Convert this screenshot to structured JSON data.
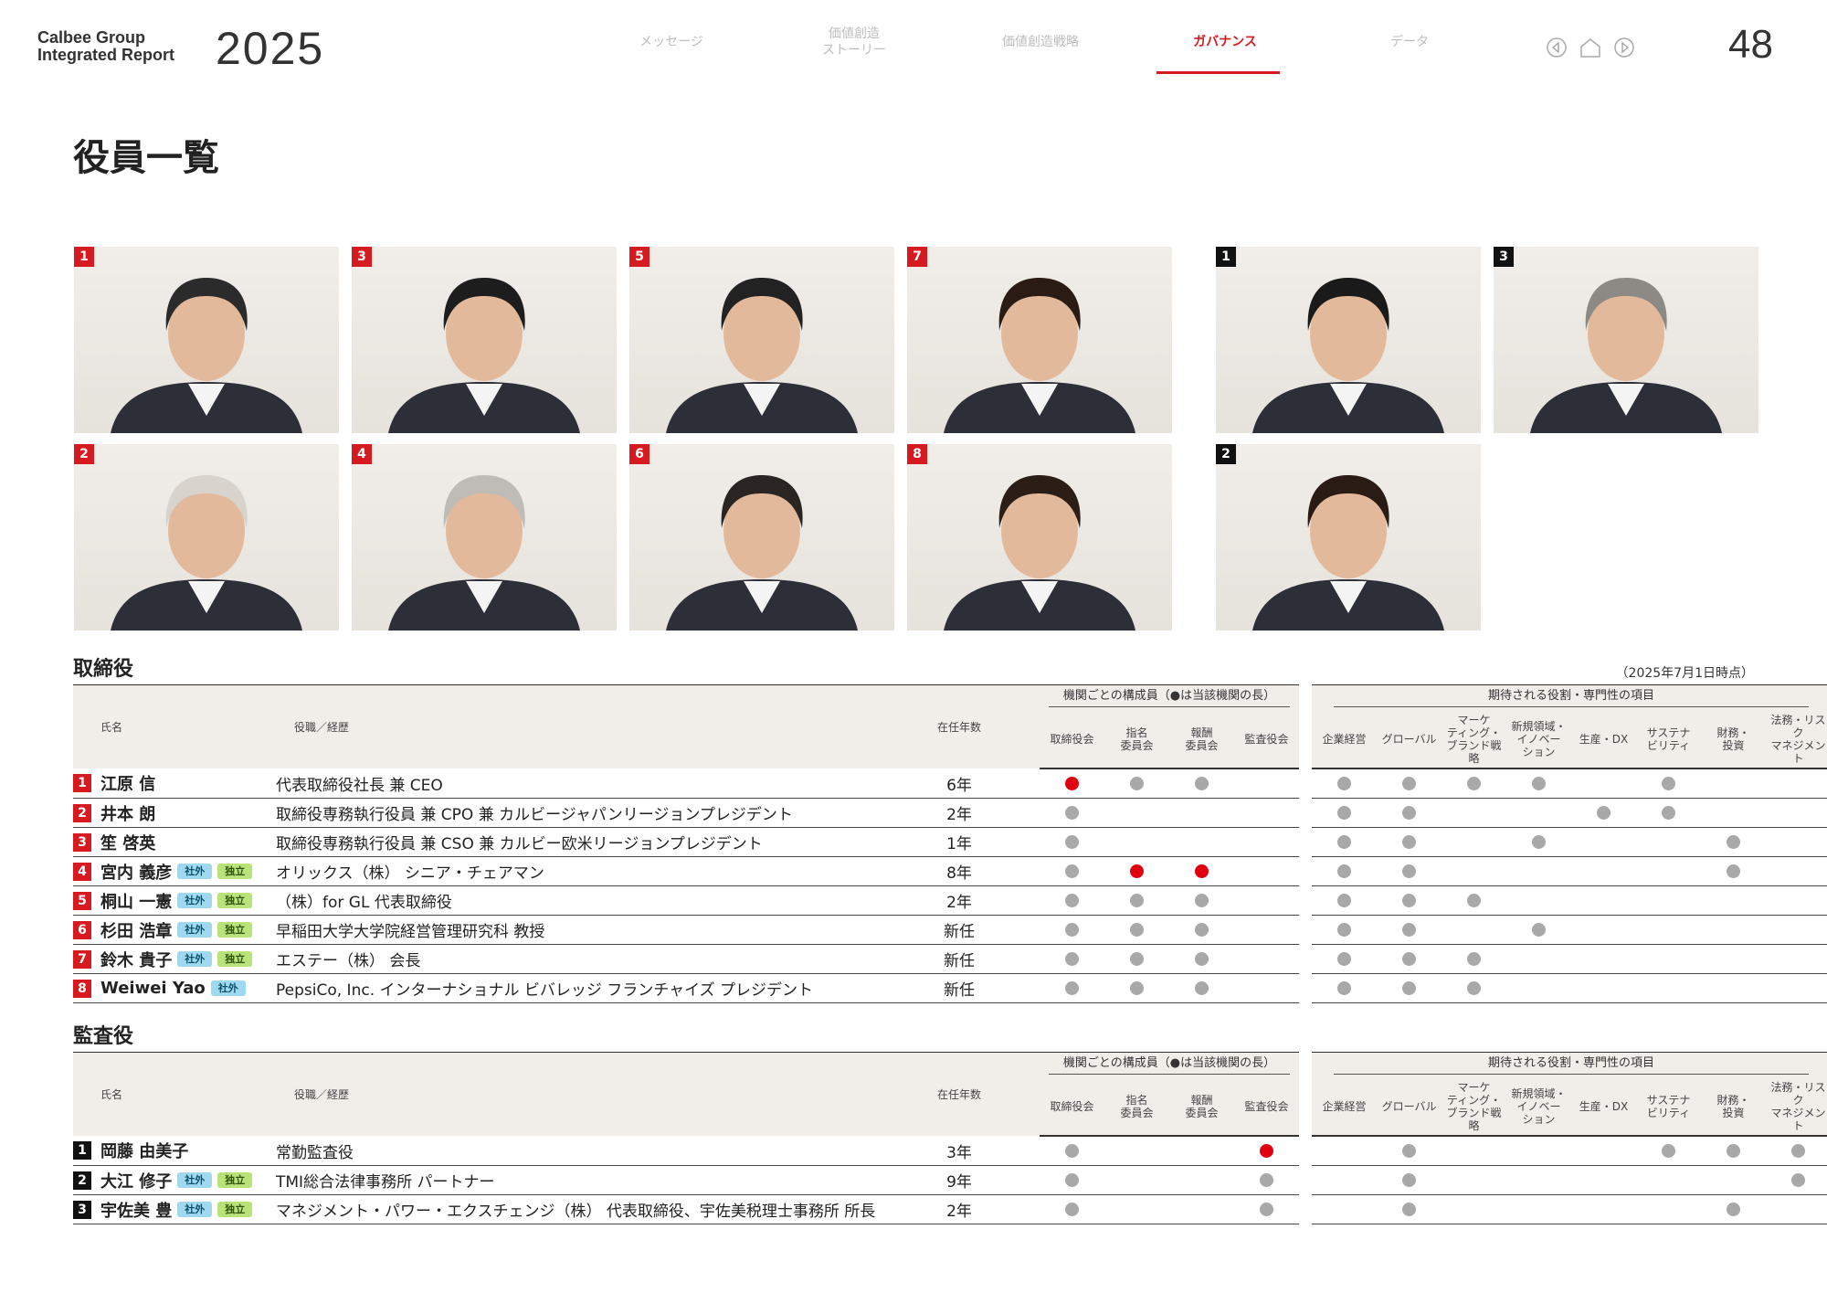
{
  "header": {
    "brand_line1": "Calbee Group",
    "brand_line2": "Integrated Report",
    "year": "2025",
    "page_number": "48",
    "nav": [
      {
        "label": "メッセージ"
      },
      {
        "label": "価値創造\nストーリー"
      },
      {
        "label": "価値創造戦略"
      },
      {
        "label": "ガバナンス"
      },
      {
        "label": "データ"
      }
    ],
    "nav_icons": [
      "prev-arrow-icon",
      "home-icon",
      "next-arrow-icon"
    ]
  },
  "title": "役員一覧",
  "colors": {
    "accent": "#d71920",
    "dot_gray": "#a8a8a8",
    "dot_red": "#e0000f",
    "header_bg": "#f1eeea"
  },
  "photos_directors": [
    "1",
    "3",
    "5",
    "7",
    "2",
    "4",
    "6",
    "8"
  ],
  "photos_auditors": [
    "1",
    "3",
    "2"
  ],
  "table_headers": {
    "name": "氏名",
    "role": "役職／経歴",
    "tenure": "在任年数",
    "group_committee": "機関ごとの構成員（●は当該機関の長）",
    "group_expertise": "期待される役割・専門性の項目",
    "committees": [
      "取締役会",
      "指名\n委員会",
      "報酬\n委員会",
      "監査役会"
    ],
    "expertise": [
      "企業経営",
      "グローバル",
      "マーケ\nティング・\nブランド戦略",
      "新規領域・\nイノベー\nション",
      "生産・DX",
      "サステナ\nビリティ",
      "財務・\n投資",
      "法務・リスク\nマネジメント"
    ]
  },
  "directors": {
    "section_title": "取締役",
    "as_of": "（2025年7月1日時点）",
    "rows": [
      {
        "num": "1",
        "name": "江原 信",
        "tags": [],
        "role": "代表取締役社長 兼 CEO",
        "tenure": "6年",
        "c": [
          "r",
          "g",
          "g",
          ""
        ],
        "e": [
          "g",
          "g",
          "g",
          "g",
          "",
          "g",
          "",
          ""
        ]
      },
      {
        "num": "2",
        "name": "井本 朗",
        "tags": [],
        "role": "取締役専務執行役員 兼 CPO 兼 カルビージャパンリージョンプレジデント",
        "tenure": "2年",
        "c": [
          "g",
          "",
          "",
          ""
        ],
        "e": [
          "g",
          "g",
          "",
          "",
          "g",
          "g",
          "",
          ""
        ]
      },
      {
        "num": "3",
        "name": "笙 啓英",
        "tags": [],
        "role": "取締役専務執行役員 兼 CSO 兼 カルビー欧米リージョンプレジデント",
        "tenure": "1年",
        "c": [
          "g",
          "",
          "",
          ""
        ],
        "e": [
          "g",
          "g",
          "",
          "g",
          "",
          "",
          "g",
          ""
        ]
      },
      {
        "num": "4",
        "name": "宮内 義彦",
        "tags": [
          "社外",
          "独立"
        ],
        "role": "オリックス（株） シニア・チェアマン",
        "tenure": "8年",
        "c": [
          "g",
          "r",
          "r",
          ""
        ],
        "e": [
          "g",
          "g",
          "",
          "",
          "",
          "",
          "g",
          ""
        ]
      },
      {
        "num": "5",
        "name": "桐山 一憲",
        "tags": [
          "社外",
          "独立"
        ],
        "role": "（株）for GL 代表取締役",
        "tenure": "2年",
        "c": [
          "g",
          "g",
          "g",
          ""
        ],
        "e": [
          "g",
          "g",
          "g",
          "",
          "",
          "",
          "",
          ""
        ]
      },
      {
        "num": "6",
        "name": "杉田 浩章",
        "tags": [
          "社外",
          "独立"
        ],
        "role": "早稲田大学大学院経営管理研究科 教授",
        "tenure": "新任",
        "c": [
          "g",
          "g",
          "g",
          ""
        ],
        "e": [
          "g",
          "g",
          "",
          "g",
          "",
          "",
          "",
          ""
        ]
      },
      {
        "num": "7",
        "name": "鈴木 貴子",
        "tags": [
          "社外",
          "独立"
        ],
        "role": "エステー（株） 会長",
        "tenure": "新任",
        "c": [
          "g",
          "g",
          "g",
          ""
        ],
        "e": [
          "g",
          "g",
          "g",
          "",
          "",
          "",
          "",
          ""
        ]
      },
      {
        "num": "8",
        "name": "Weiwei Yao",
        "tags": [
          "社外"
        ],
        "role": "PepsiCo, Inc. インターナショナル ビバレッジ フランチャイズ プレジデント",
        "tenure": "新任",
        "c": [
          "g",
          "g",
          "g",
          ""
        ],
        "e": [
          "g",
          "g",
          "g",
          "",
          "",
          "",
          "",
          ""
        ]
      }
    ]
  },
  "auditors": {
    "section_title": "監査役",
    "rows": [
      {
        "num": "1",
        "name": "岡藤 由美子",
        "tags": [],
        "role": "常勤監査役",
        "tenure": "3年",
        "c": [
          "g",
          "",
          "",
          "r"
        ],
        "e": [
          "",
          "g",
          "",
          "",
          "",
          "g",
          "g",
          "g"
        ]
      },
      {
        "num": "2",
        "name": "大江 修子",
        "tags": [
          "社外",
          "独立"
        ],
        "role": "TMI総合法律事務所 パートナー",
        "tenure": "9年",
        "c": [
          "g",
          "",
          "",
          "g"
        ],
        "e": [
          "",
          "g",
          "",
          "",
          "",
          "",
          "",
          "g"
        ]
      },
      {
        "num": "3",
        "name": "宇佐美 豊",
        "tags": [
          "社外",
          "独立"
        ],
        "role": "マネジメント・パワー・エクスチェンジ（株） 代表取締役、宇佐美税理士事務所 所長",
        "tenure": "2年",
        "c": [
          "g",
          "",
          "",
          "g"
        ],
        "e": [
          "",
          "g",
          "",
          "",
          "",
          "",
          "g",
          ""
        ]
      }
    ]
  }
}
